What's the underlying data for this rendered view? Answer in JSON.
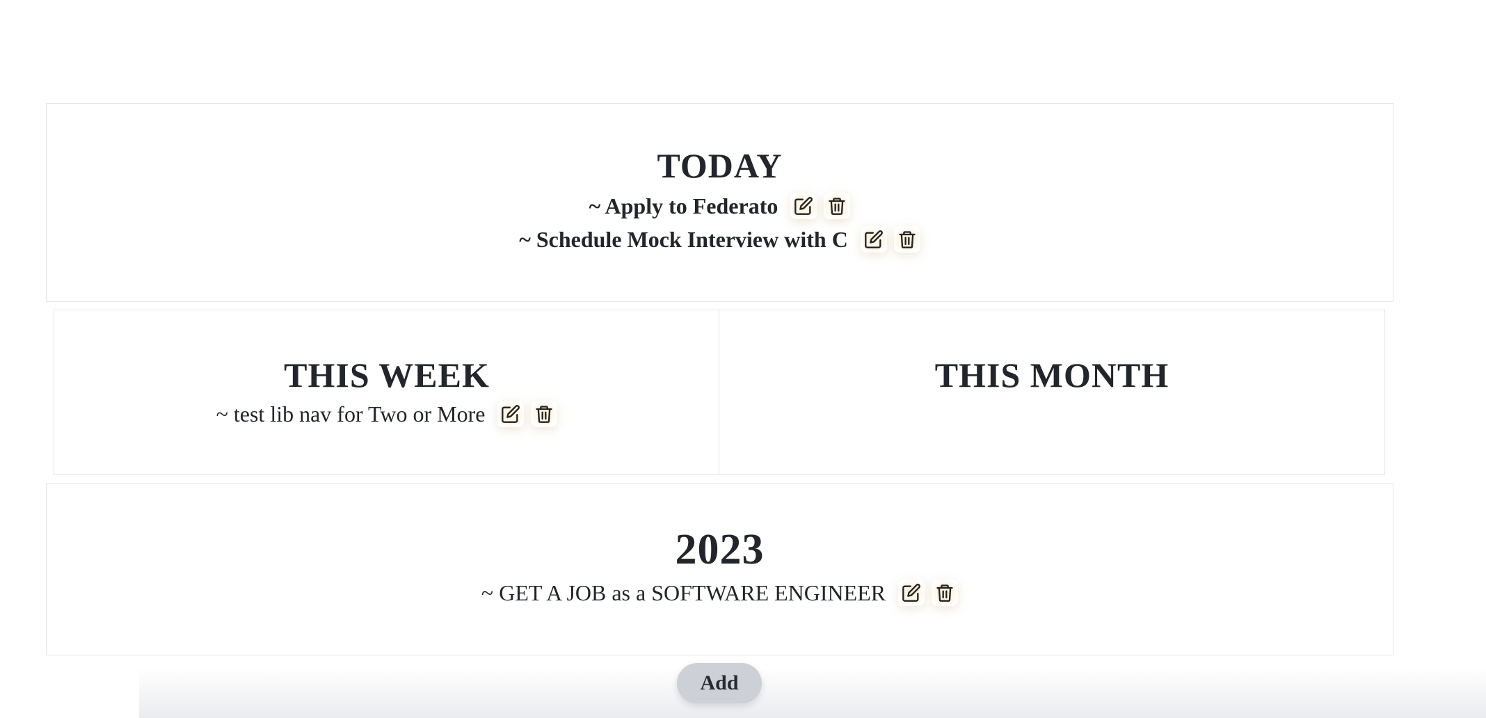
{
  "panels": {
    "today": {
      "title": "TODAY",
      "tasks": [
        {
          "text": "~ Apply to Federato"
        },
        {
          "text": "~ Schedule Mock Interview with C"
        }
      ]
    },
    "week": {
      "title": "THIS WEEK",
      "tasks": [
        {
          "text": "~ test lib nav for Two or More"
        }
      ]
    },
    "month": {
      "title": "THIS MONTH",
      "tasks": []
    },
    "year": {
      "title": "2023",
      "tasks": [
        {
          "text": "~ GET A JOB as a SOFTWARE ENGINEER"
        }
      ]
    }
  },
  "actions": {
    "add_label": "Add"
  },
  "icons": {
    "edit": "pencil-square-icon",
    "delete": "trash-icon"
  }
}
